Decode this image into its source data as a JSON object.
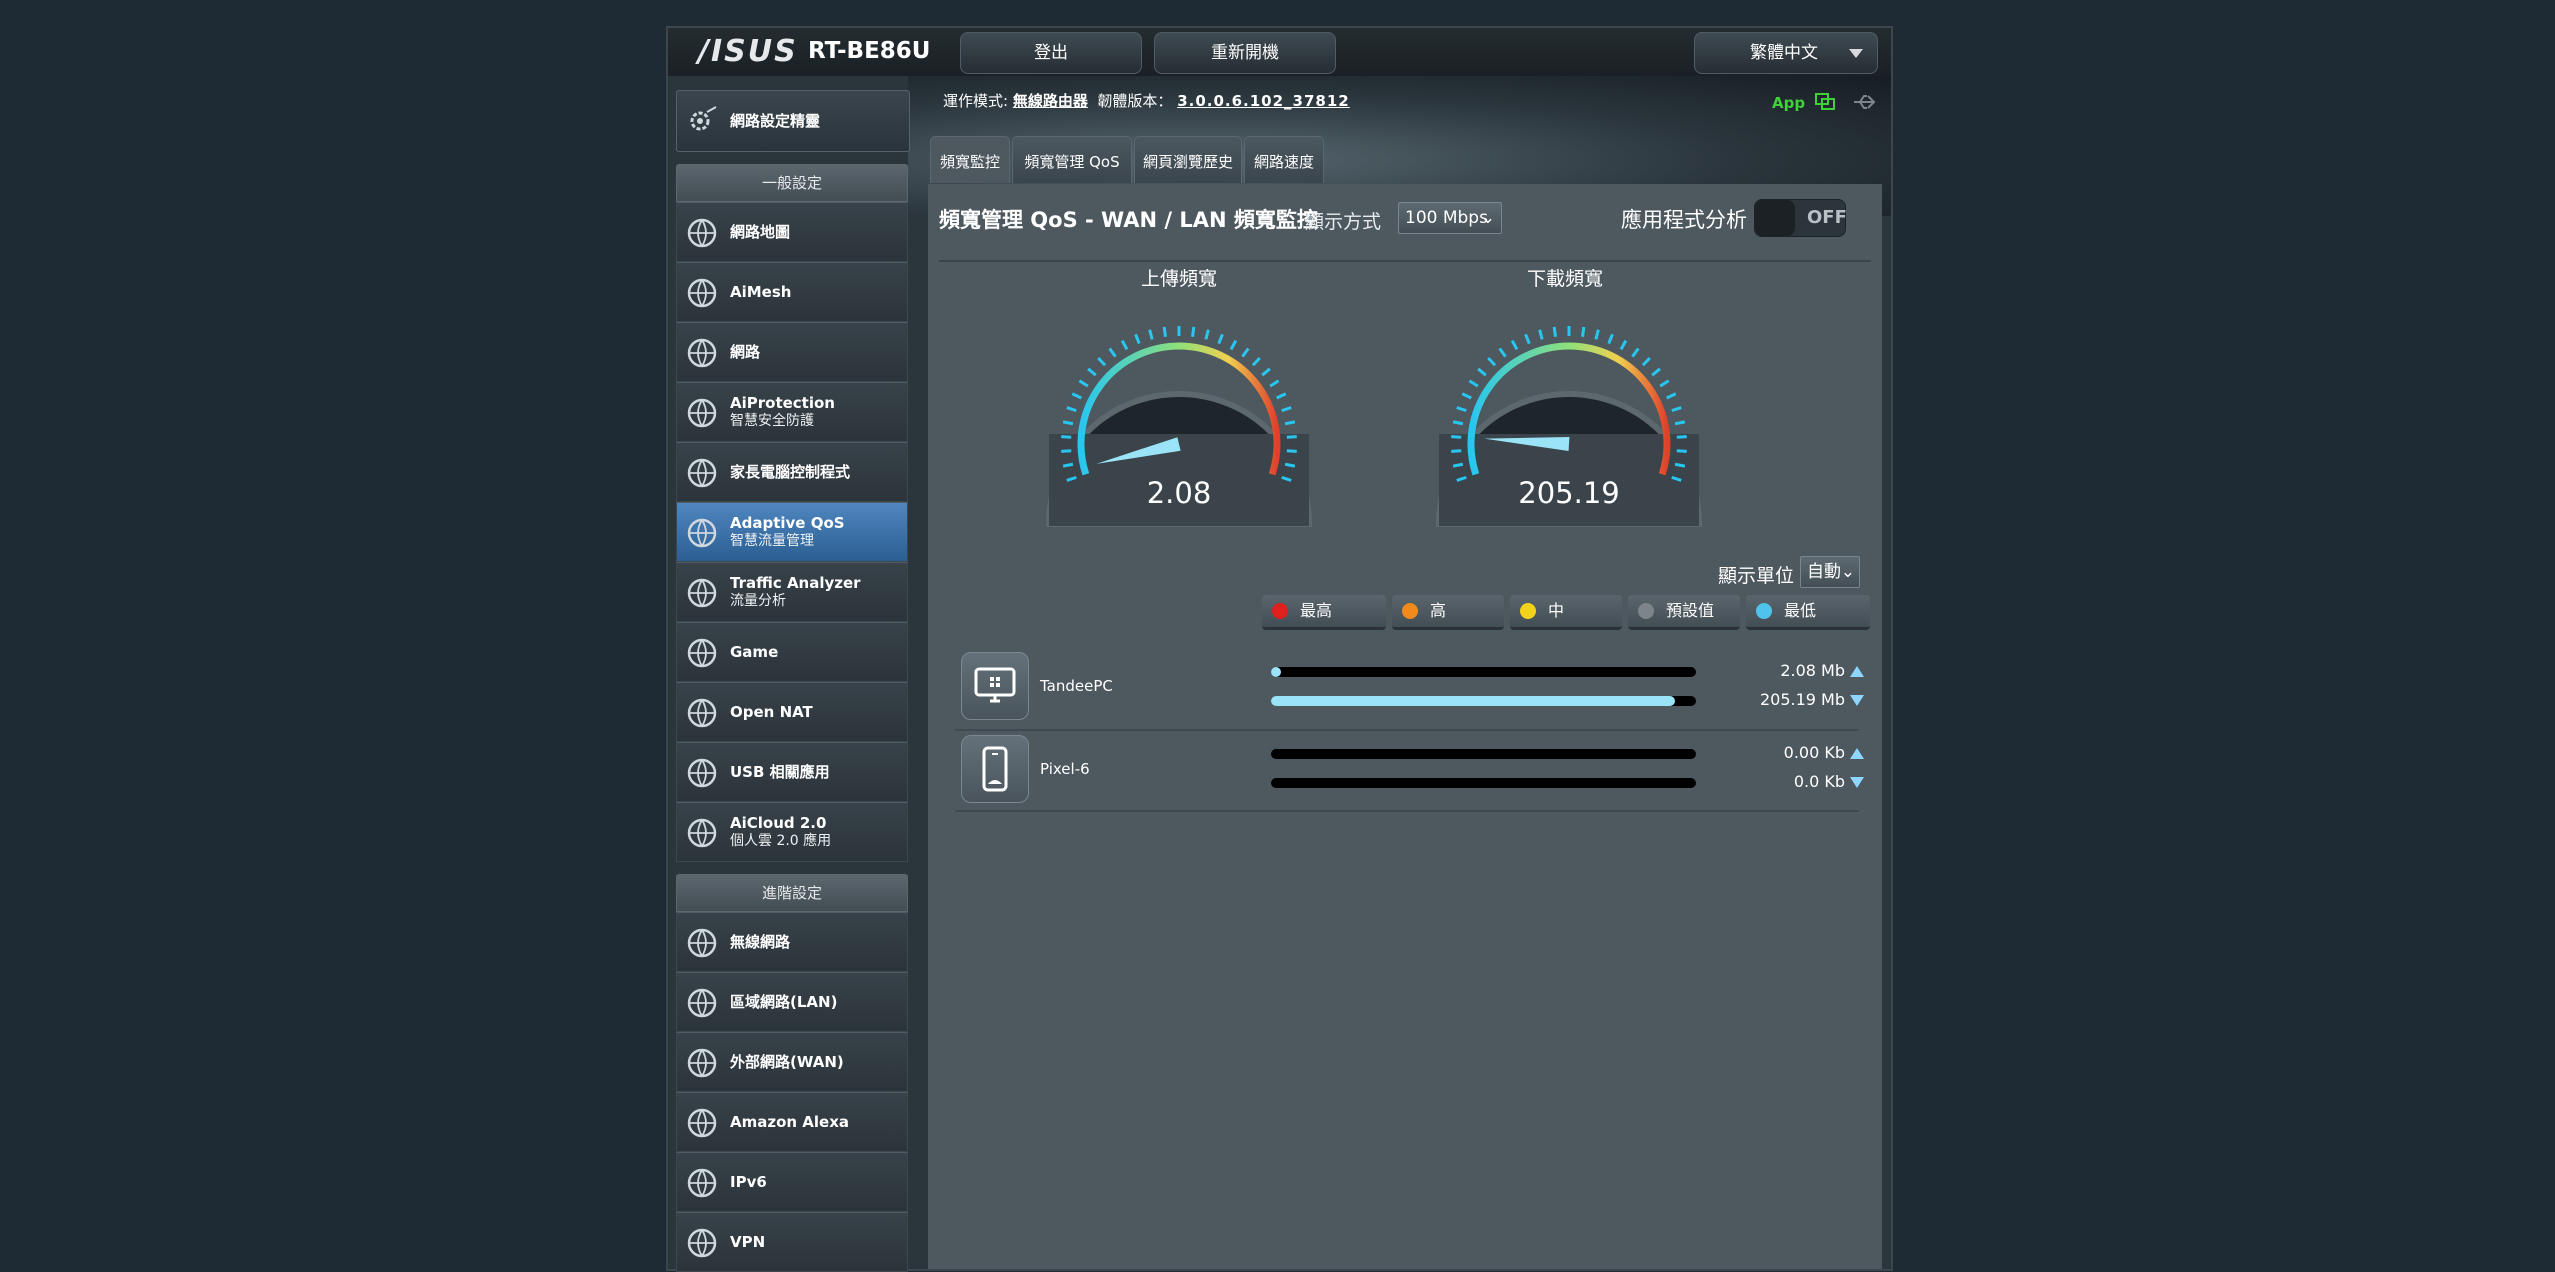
{
  "header": {
    "logo": "/ISUS",
    "model": "RT-BE86U",
    "logout": "登出",
    "reboot": "重新開機",
    "language": "繁體中文"
  },
  "status": {
    "mode_label": "運作模式:",
    "mode_value": "無線路由器",
    "firmware_label": "韌體版本：",
    "firmware_value": "3.0.0.6.102_37812",
    "app_label": "App"
  },
  "sidebar": {
    "wizard": "網路設定精靈",
    "general_title": "一般設定",
    "general": [
      {
        "label": "網路地圖",
        "sub": "",
        "icon": "network-map-icon"
      },
      {
        "label": "AiMesh",
        "sub": "",
        "icon": "aimesh-icon"
      },
      {
        "label": "網路",
        "sub": "",
        "icon": "globe-network-icon"
      },
      {
        "label": "AiProtection",
        "sub": "智慧安全防護",
        "icon": "shield-lock-icon"
      },
      {
        "label": "家長電腦控制程式",
        "sub": "",
        "icon": "parental-control-icon"
      },
      {
        "label": "Adaptive QoS",
        "sub": "智慧流量管理",
        "icon": "speedometer-icon"
      },
      {
        "label": "Traffic Analyzer",
        "sub": "流量分析",
        "icon": "traffic-wave-icon"
      },
      {
        "label": "Game",
        "sub": "",
        "icon": "gamepad-icon"
      },
      {
        "label": "Open NAT",
        "sub": "",
        "icon": "open-nat-icon"
      },
      {
        "label": "USB 相關應用",
        "sub": "",
        "icon": "usb-icon"
      },
      {
        "label": "AiCloud 2.0",
        "sub": "個人雲 2.0 應用",
        "icon": "cloud-icon"
      }
    ],
    "advanced_title": "進階設定",
    "advanced": [
      {
        "label": "無線網路",
        "sub": "",
        "icon": "wireless-icon"
      },
      {
        "label": "區域網路(LAN)",
        "sub": "",
        "icon": "lan-icon"
      },
      {
        "label": "外部網路(WAN)",
        "sub": "",
        "icon": "wan-globe-icon"
      },
      {
        "label": "Amazon Alexa",
        "sub": "",
        "icon": "alexa-icon"
      },
      {
        "label": "IPv6",
        "sub": "",
        "icon": "ipv6-icon"
      },
      {
        "label": "VPN",
        "sub": "",
        "icon": "vpn-icon"
      }
    ]
  },
  "tabs": [
    "頻寬監控",
    "頻寬管理 QoS",
    "網頁瀏覽歷史",
    "網路速度"
  ],
  "panel": {
    "title": "頻寬管理 QoS - WAN / LAN 頻寬監控",
    "display_mode_label": "顯示方式",
    "display_mode_value": "100 Mbps",
    "app_analysis_label": "應用程式分析",
    "app_analysis_toggle": "OFF",
    "upload_title": "上傳頻寬",
    "download_title": "下載頻寬",
    "upload_value": "2.08",
    "download_value": "205.19",
    "unit_label": "顯示單位",
    "unit_value": "自動",
    "legend": [
      {
        "label": "最高",
        "color": "#e0201c"
      },
      {
        "label": "高",
        "color": "#f08a1c"
      },
      {
        "label": "中",
        "color": "#f3d31a"
      },
      {
        "label": "預設值",
        "color": "#7d858a"
      },
      {
        "label": "最低",
        "color": "#4fc3ec"
      }
    ]
  },
  "gauges": {
    "upload_fraction": 0.0208,
    "download_fraction": 0.1,
    "needle_color": "#9be3f7"
  },
  "devices": [
    {
      "name": "TandeePC",
      "icon": "desktop-monitor-icon",
      "upload": "2.08 Mb",
      "download": "205.19 Mb",
      "up_fraction": 0.01,
      "down_fraction": 0.95
    },
    {
      "name": "Pixel-6",
      "icon": "smartphone-icon",
      "upload": "0.00 Kb",
      "download": "0.0 Kb",
      "up_fraction": 0,
      "down_fraction": 0
    }
  ]
}
